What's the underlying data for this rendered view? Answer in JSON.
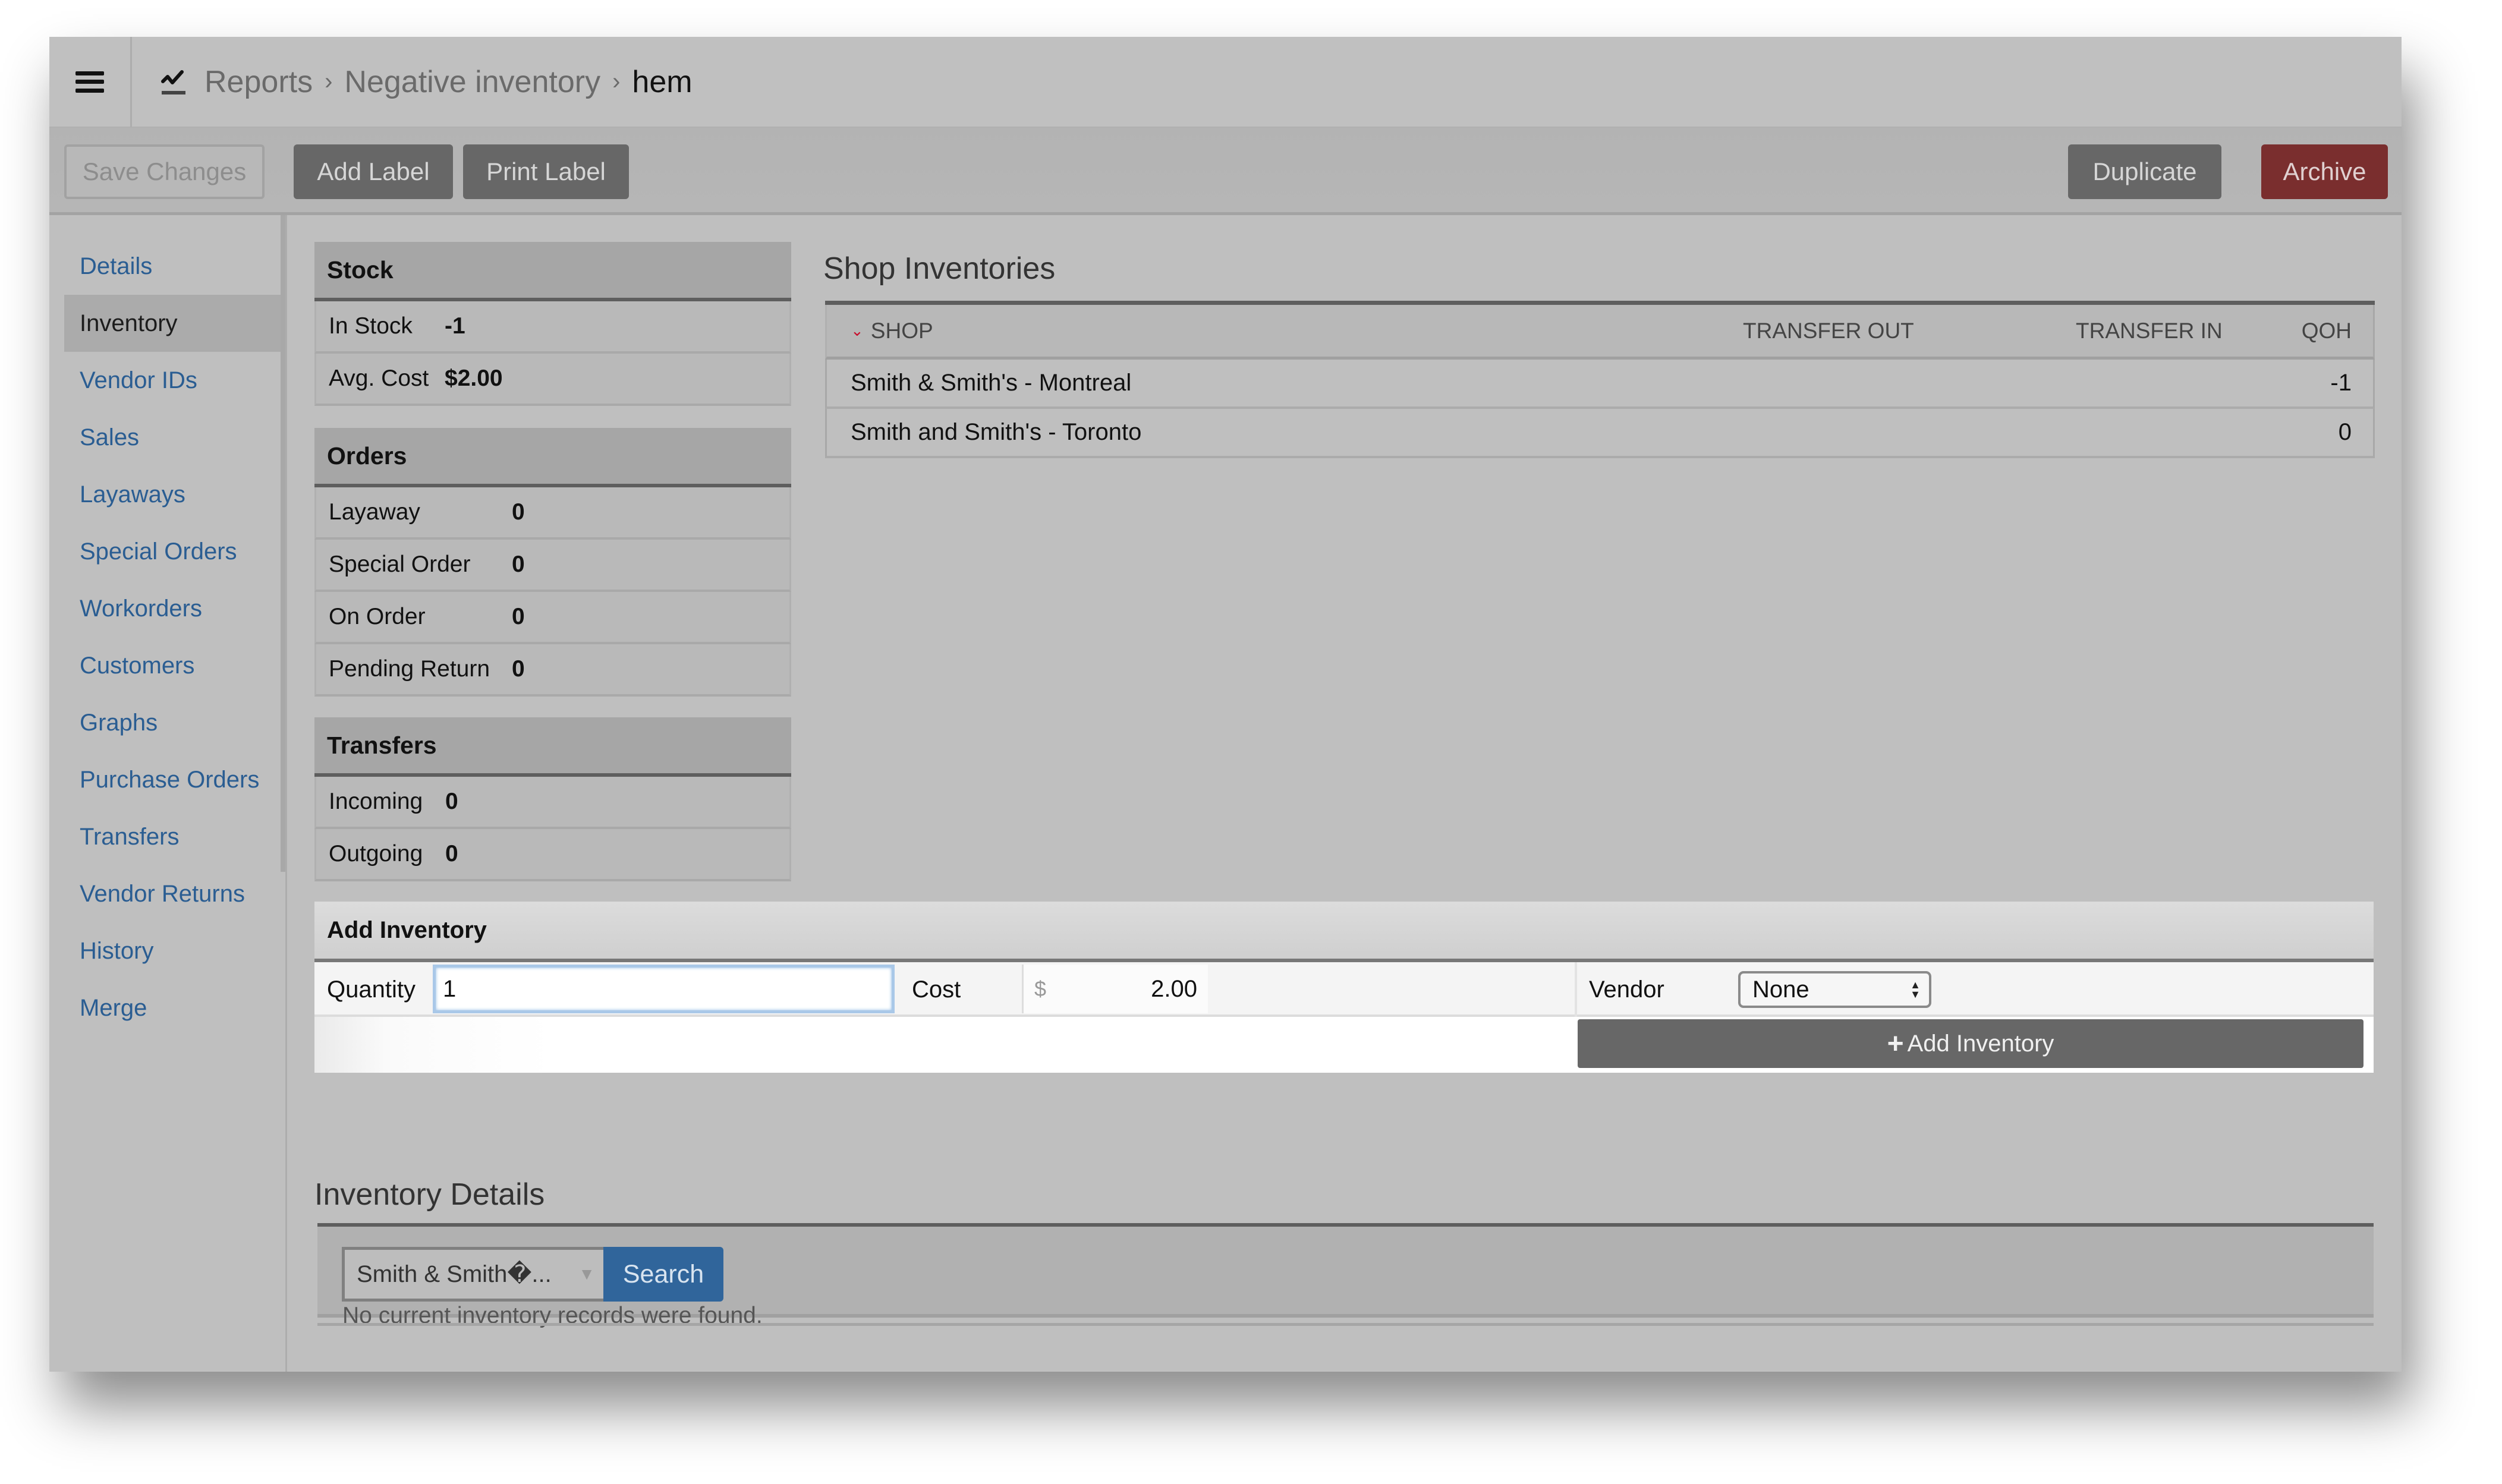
{
  "header": {
    "menu_icon": "hamburger-icon",
    "report_icon": "line-chart-icon",
    "breadcrumb": [
      {
        "label": "Reports"
      },
      {
        "label": "Negative inventory"
      }
    ],
    "separator": "›",
    "current": "hem"
  },
  "toolbar": {
    "save_label": "Save Changes",
    "add_label_label": "Add Label",
    "print_label_label": "Print Label",
    "duplicate_label": "Duplicate",
    "archive_label": "Archive",
    "archive_color": "#7a2e2e"
  },
  "sidebar": {
    "items": [
      {
        "label": "Details",
        "active": false
      },
      {
        "label": "Inventory",
        "active": true
      },
      {
        "label": "Vendor IDs",
        "active": false
      },
      {
        "label": "Sales",
        "active": false
      },
      {
        "label": "Layaways",
        "active": false
      },
      {
        "label": "Special Orders",
        "active": false
      },
      {
        "label": "Workorders",
        "active": false
      },
      {
        "label": "Customers",
        "active": false
      },
      {
        "label": "Graphs",
        "active": false
      },
      {
        "label": "Purchase Orders",
        "active": false
      },
      {
        "label": "Transfers",
        "active": false
      },
      {
        "label": "Vendor Returns",
        "active": false
      },
      {
        "label": "History",
        "active": false
      },
      {
        "label": "Merge",
        "active": false
      }
    ],
    "link_color": "#2a5d92"
  },
  "stock": {
    "title": "Stock",
    "rows": [
      {
        "label": "In Stock",
        "value": "-1"
      },
      {
        "label": "Avg. Cost",
        "value": "$2.00"
      }
    ]
  },
  "orders": {
    "title": "Orders",
    "rows": [
      {
        "label": "Layaway",
        "value": "0"
      },
      {
        "label": "Special Order",
        "value": "0"
      },
      {
        "label": "On Order",
        "value": "0"
      },
      {
        "label": "Pending Return",
        "value": "0"
      }
    ]
  },
  "transfers": {
    "title": "Transfers",
    "rows": [
      {
        "label": "Incoming",
        "value": "0"
      },
      {
        "label": "Outgoing",
        "value": "0"
      }
    ]
  },
  "shop_inventories": {
    "title": "Shop Inventories",
    "sort_icon": "chevron-down-icon",
    "columns": [
      "SHOP",
      "TRANSFER OUT",
      "TRANSFER IN",
      "QOH"
    ],
    "rows": [
      {
        "shop": "Smith & Smith's - Montreal",
        "transfer_out": "",
        "transfer_in": "",
        "qoh": "-1"
      },
      {
        "shop": "Smith and Smith's - Toronto",
        "transfer_out": "",
        "transfer_in": "",
        "qoh": "0"
      }
    ]
  },
  "add_inventory": {
    "title": "Add Inventory",
    "quantity_label": "Quantity",
    "quantity_value": "1",
    "cost_label": "Cost",
    "cost_currency": "$",
    "cost_value": "2.00",
    "vendor_label": "Vendor",
    "vendor_selected": "None",
    "button_icon": "plus-icon",
    "button_label": "Add Inventory"
  },
  "inventory_details": {
    "title": "Inventory Details",
    "shop_select_value": "Smith & Smith�...",
    "search_label": "Search",
    "search_color": "#30659b",
    "empty_message": "No current inventory records were found."
  }
}
